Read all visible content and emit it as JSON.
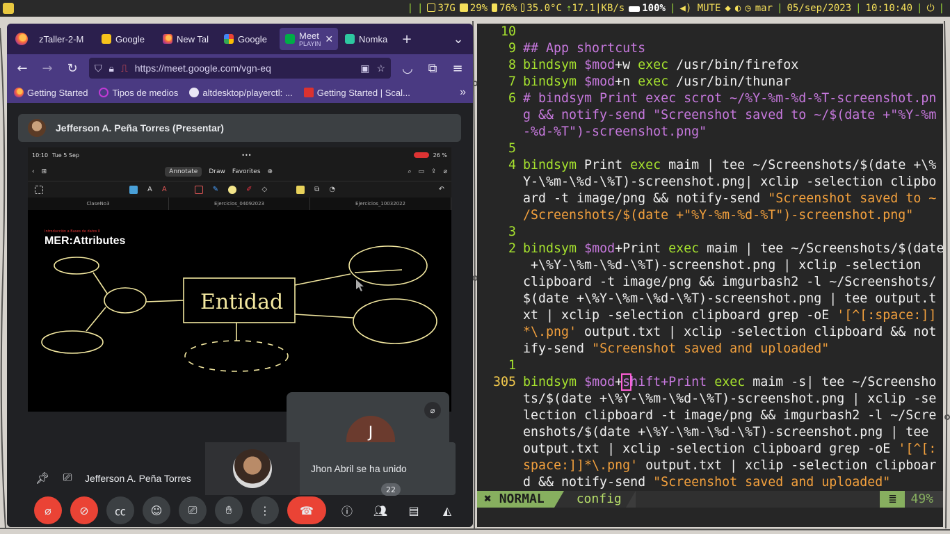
{
  "colors": {
    "accent": "#4a3a82",
    "vim_green": "#a6e22e",
    "vim_purple": "#c678dd",
    "vim_orange": "#f2a03d",
    "meet_red": "#ea4335"
  },
  "topbar": {
    "storage": "37G",
    "cpu": "29%",
    "memory": "76%",
    "temperature": "35.0°C",
    "network": "17.1|KB/s",
    "brightness": "100%",
    "volume": "MUTE",
    "weekday": "mar",
    "date": "05/sep/2023",
    "time": "10:10:40",
    "icons": [
      "disk-icon",
      "cpu-icon",
      "memory-icon",
      "thermometer-icon",
      "network-icon",
      "brightness-icon",
      "volume-icon",
      "note-icon",
      "moon-icon",
      "clock-icon",
      "power-icon"
    ]
  },
  "browser": {
    "tabs": [
      {
        "label": "zTaller-2-M",
        "sub": "",
        "icon": "firefox-icon"
      },
      {
        "label": "Google",
        "sub": "",
        "icon": "google-keep-icon"
      },
      {
        "label": "New Tal",
        "sub": "",
        "icon": "firefox-icon"
      },
      {
        "label": "Google",
        "sub": "",
        "icon": "google-icon"
      },
      {
        "label": "Meet",
        "sub": "PLAYIN",
        "icon": "meet-icon"
      },
      {
        "label": "Nomka",
        "sub": "",
        "icon": "app-icon"
      }
    ],
    "url": "https://meet.google.com/vgn-eq",
    "bookmarks": [
      {
        "label": "Getting Started",
        "icon": "firefox-icon"
      },
      {
        "label": "Tipos de medios",
        "icon": "ring-icon"
      },
      {
        "label": "altdesktop/playerctl: ...",
        "icon": "github-icon"
      },
      {
        "label": "Getting Started | Scal...",
        "icon": "scala-icon"
      }
    ]
  },
  "meet": {
    "presenter_banner": "Jefferson A. Peña Torres (Presentar)",
    "presenter_name": "Jefferson A. Peña Torres",
    "toast_text": "Jhon Abril se ha unido",
    "self_initial": "J",
    "participants_count": "22",
    "shared_screen": {
      "status_time": "10:10",
      "status_date": "Tue 5 Sep",
      "battery": "26 %",
      "tab_annotate": "Annotate",
      "tab_draw": "Draw",
      "tab_favorites": "Favorites",
      "doc_tabs": [
        "ClaseNo3",
        "Ejercicios_04092023",
        "Ejercicios_10032022"
      ],
      "slide_kicker": "Introducción a Bases de datos II",
      "slide_title": "MER:Attributes",
      "handwritten_label": "Entidad"
    }
  },
  "terminal": {
    "lines": [
      {
        "num": "10",
        "current": false
      },
      {
        "num": "9",
        "current": false
      },
      {
        "num": "8",
        "current": false
      },
      {
        "num": "7",
        "current": false
      },
      {
        "num": "6",
        "current": false
      },
      {
        "num": "",
        "current": false
      },
      {
        "num": "",
        "current": false
      },
      {
        "num": "5",
        "current": false
      },
      {
        "num": "4",
        "current": false
      },
      {
        "num": "",
        "current": false
      },
      {
        "num": "",
        "current": false
      },
      {
        "num": "",
        "current": false
      },
      {
        "num": "3",
        "current": false
      },
      {
        "num": "2",
        "current": false
      },
      {
        "num": "",
        "current": false
      },
      {
        "num": "",
        "current": false
      },
      {
        "num": "",
        "current": false
      },
      {
        "num": "",
        "current": false
      },
      {
        "num": "",
        "current": false
      },
      {
        "num": "",
        "current": false
      },
      {
        "num": "1",
        "current": false
      },
      {
        "num": "305",
        "current": true
      },
      {
        "num": "",
        "current": false
      },
      {
        "num": "",
        "current": false
      },
      {
        "num": "",
        "current": false
      },
      {
        "num": "",
        "current": false
      },
      {
        "num": "",
        "current": false
      },
      {
        "num": "",
        "current": false
      }
    ],
    "code": {
      "l9": "## App shortcuts",
      "l8": [
        "bindsym",
        " ",
        "$mod",
        "+w ",
        "exec",
        " /usr/bin/firefox"
      ],
      "l7": [
        "bindsym",
        " ",
        "$mod",
        "+n ",
        "exec",
        " /usr/bin/thunar"
      ],
      "l6a": "# bindsym Print exec scrot ~/%Y-%m-%d-%T-screenshot.pn",
      "l6b": "g && notify-send \"Screenshot saved to ~/$(date +\"%Y-%m",
      "l6c": "-%d-%T\")-screenshot.png\"",
      "l4a": [
        "bindsym",
        " Print ",
        "exec",
        " maim | tee ~/Screenshots/$(date +\\%"
      ],
      "l4b": "Y-\\%m-\\%d-\\%T)-screenshot.png| xclip -selection clipbo",
      "l4c": [
        "ard -t image/png && notify-send ",
        "\"Screenshot saved to ~"
      ],
      "l4d": "/Screenshots/$(date +\"%Y-%m-%d-%T\")-screenshot.png\"",
      "l2a": [
        "bindsym",
        " ",
        "$mod",
        "+Print ",
        "exec",
        " maim | tee ~/Screenshots/$(da",
        "te"
      ],
      "l2b": " +\\%Y-\\%m-\\%d-\\%T)-screenshot.png | xclip -selection",
      "l2c": "clipboard -t image/png && imgurbash2 -l ~/Screenshots/",
      "l2d": "$(date +\\%Y-\\%m-\\%d-\\%T)-screenshot.png | tee output.t",
      "l2e": [
        "xt | xclip -selection clipboard grep -oE ",
        "'[^[:space:]]"
      ],
      "l2f": [
        "*\\.png'",
        " output.txt | xclip -selection clipboard && not"
      ],
      "l2g": [
        "ify-send ",
        "\"Screenshot saved and uploaded\""
      ],
      "l305a": [
        "bindsym",
        " ",
        "$mod",
        "+",
        "s",
        "hift+Print ",
        "exec",
        " maim -s| tee ~/Screensho"
      ],
      "l305b": "ts/$(date +\\%Y-\\%m-\\%d-\\%T)-screenshot.png | xclip -se",
      "l305c": "lection clipboard -t image/png && imgurbash2 -l ~/Scre",
      "l305d": "enshots/$(date +\\%Y-\\%m-\\%d-\\%T)-screenshot.png | tee",
      "l305e": [
        "output.txt | xclip -selection clipboard grep -oE ",
        "'[^[:"
      ],
      "l305f": [
        "space:]]*\\.png'",
        " output.txt | xclip -selection clipboar"
      ],
      "l305g": [
        "d && notify-send ",
        "\"Screenshot saved and uploaded\""
      ]
    },
    "status": {
      "mode": "NORMAL",
      "file": "config",
      "percent": "49%"
    }
  }
}
